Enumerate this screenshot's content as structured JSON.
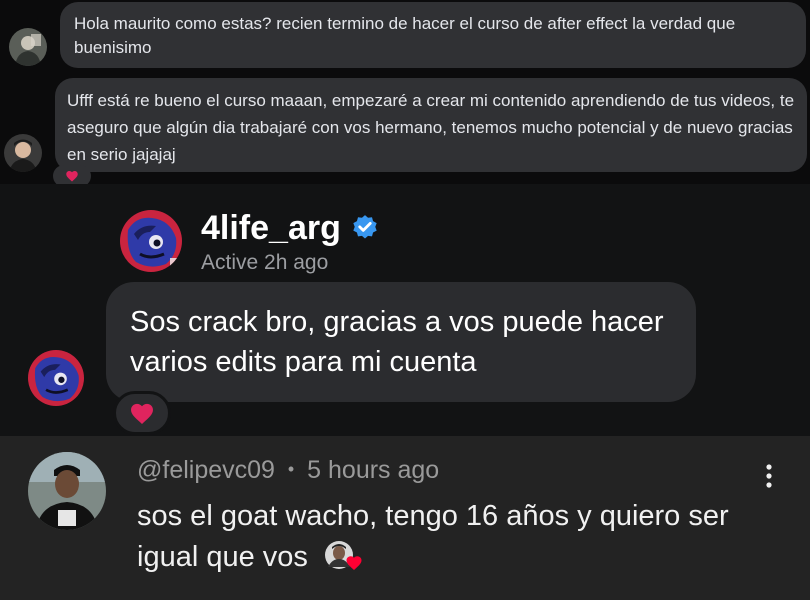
{
  "messenger": {
    "comment1": {
      "text": "Hola maurito como estas? recien termino de hacer el curso de after effect la verdad que buenisimo"
    },
    "comment2": {
      "text": "Ufff está re bueno el curso maaan, empezaré a crear mi contenido  aprendiendo de tus videos, te aseguro que algún dia trabajaré con vos hermano, tenemos mucho potencial y de nuevo gracias en serio jajajaj"
    }
  },
  "dm": {
    "username": "4life_arg",
    "status": "Active 2h ago",
    "message": "Sos crack bro, gracias a vos puede hacer varios edits para mi cuenta",
    "reaction_icon": "heart-icon"
  },
  "youtube": {
    "handle": "@felipevc09",
    "separator": "•",
    "time": "5 hours ago",
    "comment": "sos el goat wacho, tengo 16 años y quiero ser igual que vos",
    "menu_icon": "more-vertical-icon"
  },
  "colors": {
    "heart": "#e0245e",
    "verified": "#3897f0",
    "bubble_dark": "#303134"
  }
}
